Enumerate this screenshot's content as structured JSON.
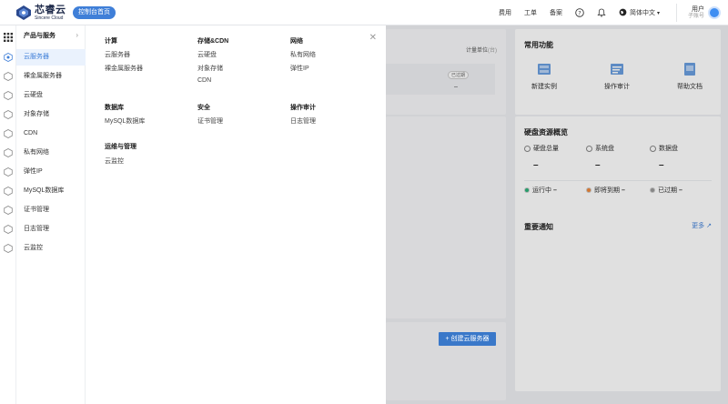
{
  "header": {
    "logo_cn": "芯睿云",
    "logo_en": "Sincere Cloud",
    "console_badge": "控制台首页",
    "links": [
      "费用",
      "工单",
      "备案"
    ],
    "language": "简体中文",
    "user_name": "用户",
    "user_sub": "子账号"
  },
  "sidebar": {
    "title": "产品与服务",
    "items": [
      {
        "label": "云服务器",
        "icon": "server-icon",
        "active": true
      },
      {
        "label": "裸金属服务器",
        "icon": "bare-metal-icon"
      },
      {
        "label": "云硬盘",
        "icon": "disk-icon"
      },
      {
        "label": "对象存储",
        "icon": "storage-icon"
      },
      {
        "label": "CDN",
        "icon": "cdn-icon"
      },
      {
        "label": "私有网络",
        "icon": "network-icon"
      },
      {
        "label": "弹性IP",
        "icon": "ip-icon"
      },
      {
        "label": "MySQL数据库",
        "icon": "database-icon"
      },
      {
        "label": "证书管理",
        "icon": "certificate-icon"
      },
      {
        "label": "日志管理",
        "icon": "log-icon"
      },
      {
        "label": "云监控",
        "icon": "monitor-icon"
      }
    ]
  },
  "panel": {
    "groups": [
      {
        "title": "计算",
        "items": [
          "云服务器",
          "裸金属服务器"
        ]
      },
      {
        "title": "存储&CDN",
        "items": [
          "云硬盘",
          "对象存储",
          "CDN"
        ]
      },
      {
        "title": "网络",
        "items": [
          "私有网络",
          "弹性IP"
        ]
      },
      {
        "title": "数据库",
        "items": [
          "MySQL数据库"
        ]
      },
      {
        "title": "安全",
        "items": [
          "证书管理"
        ]
      },
      {
        "title": "操作审计",
        "items": [
          "日志管理"
        ]
      },
      {
        "title": "运维与管理",
        "items": [
          "云监控"
        ]
      }
    ]
  },
  "background": {
    "unit_label": "计量单位",
    "unit_value": "(台)",
    "expired_tag": "已过期",
    "dash": "–",
    "create_button": "创建云服务器"
  },
  "quick": {
    "title": "常用功能",
    "items": [
      {
        "label": "新建实例",
        "icon": "new-instance-icon"
      },
      {
        "label": "操作审计",
        "icon": "audit-icon"
      },
      {
        "label": "帮助文档",
        "icon": "docs-icon"
      }
    ]
  },
  "disk": {
    "title": "硬盘资源概览",
    "stats": [
      {
        "label": "硬盘总量",
        "value": "–"
      },
      {
        "label": "系统盘",
        "value": "–"
      },
      {
        "label": "数据盘",
        "value": "–"
      }
    ],
    "statuses": [
      {
        "label": "运行中",
        "value": "–",
        "color": "#2db37a"
      },
      {
        "label": "即将到期",
        "value": "–",
        "color": "#f0883a"
      },
      {
        "label": "已过期",
        "value": "–",
        "color": "#999999"
      }
    ]
  },
  "notice": {
    "title": "重要通知",
    "more": "更多"
  },
  "colors": {
    "accent": "#3f7fd8",
    "active_bg": "#eaf2fd"
  }
}
